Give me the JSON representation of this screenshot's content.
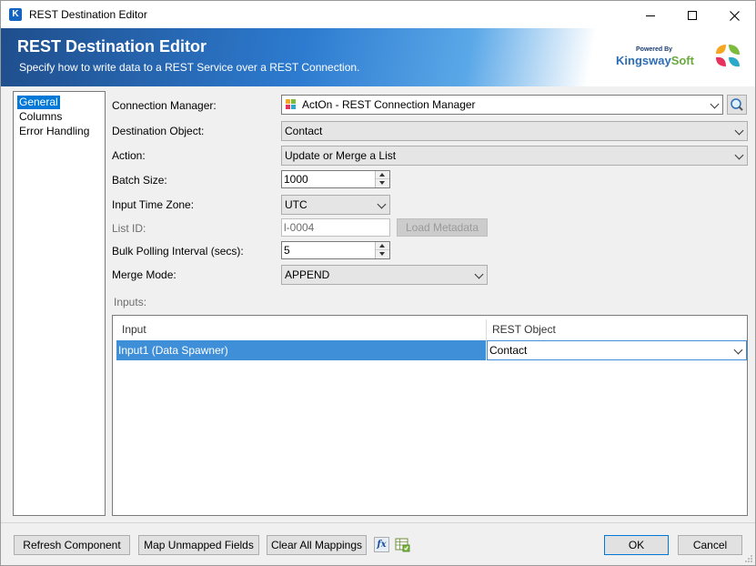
{
  "window": {
    "title": "REST Destination Editor",
    "icon": "k-app-icon",
    "controls": {
      "minimize": "minimize-icon",
      "maximize": "maximize-icon",
      "close": "close-icon"
    }
  },
  "banner": {
    "title": "REST Destination Editor",
    "subtitle": "Specify how to write data to a REST Service over a REST Connection.",
    "powered_by": "Powered By",
    "brand_name_a": "Kingsway",
    "brand_name_b": "Soft"
  },
  "nav": {
    "items": [
      {
        "label": "General",
        "selected": true
      },
      {
        "label": "Columns",
        "selected": false
      },
      {
        "label": "Error Handling",
        "selected": false
      }
    ]
  },
  "form": {
    "connection_manager": {
      "label": "Connection Manager:",
      "value": "ActOn - REST Connection Manager"
    },
    "destination_object": {
      "label": "Destination Object:",
      "value": "Contact"
    },
    "action": {
      "label": "Action:",
      "value": "Update or Merge a List"
    },
    "batch_size": {
      "label": "Batch Size:",
      "value": "1000"
    },
    "input_time_zone": {
      "label": "Input Time Zone:",
      "value": "UTC"
    },
    "list_id": {
      "label": "List ID:",
      "value": "l-0004",
      "load_metadata_label": "Load Metadata"
    },
    "bulk_polling_interval": {
      "label": "Bulk Polling Interval (secs):",
      "value": "5"
    },
    "merge_mode": {
      "label": "Merge Mode:",
      "value": "APPEND"
    },
    "inputs_label": "Inputs:"
  },
  "grid": {
    "columns": [
      "Input",
      "REST Object"
    ],
    "rows": [
      {
        "input": "Input1 (Data Spawner)",
        "rest_object": "Contact"
      }
    ]
  },
  "footer": {
    "refresh_component": "Refresh Component",
    "map_unmapped_fields": "Map Unmapped Fields",
    "clear_all_mappings": "Clear All Mappings",
    "fx_label": "fx",
    "ok": "OK",
    "cancel": "Cancel"
  },
  "colors": {
    "selection": "#0078d7",
    "row_highlight": "#3f8fd8",
    "banner_dark": "#1f4e8c"
  }
}
